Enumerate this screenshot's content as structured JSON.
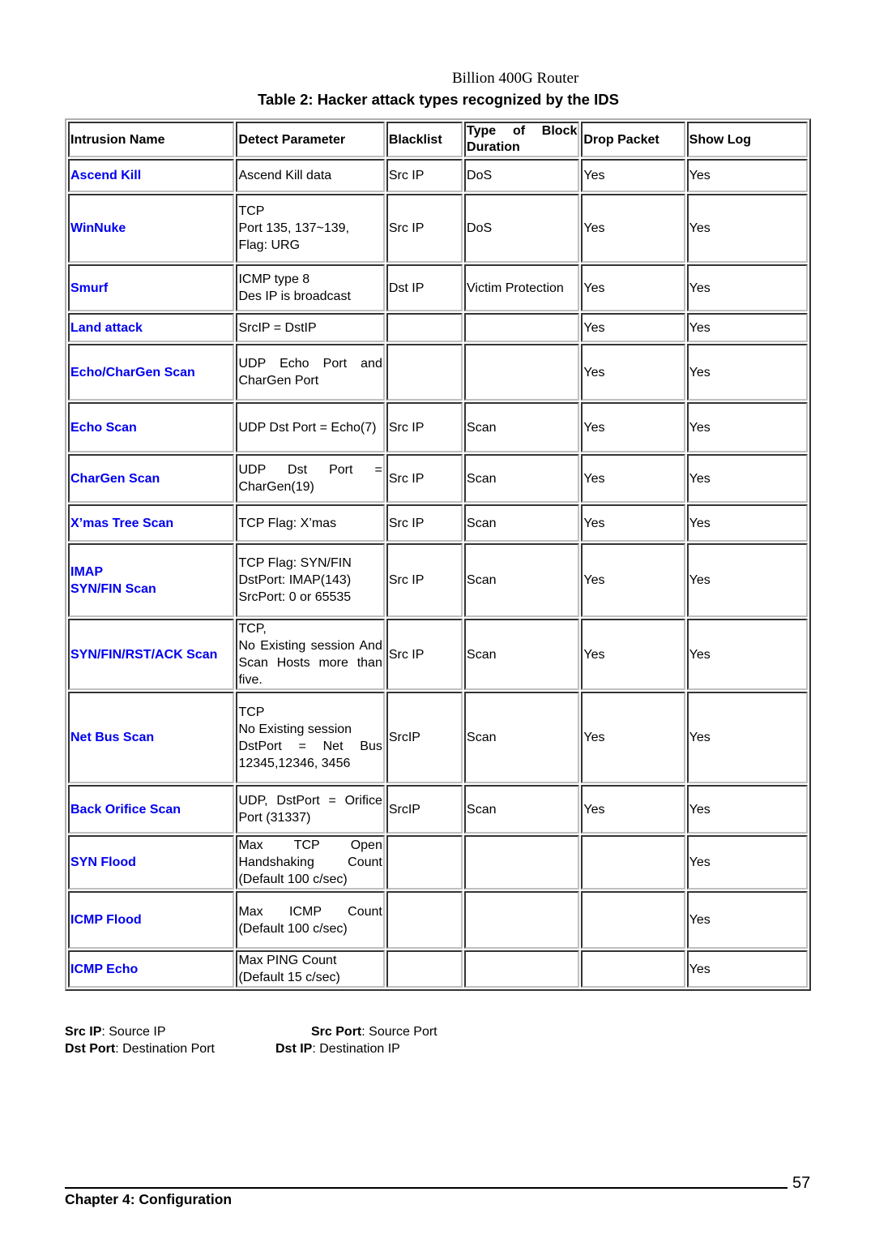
{
  "header": {
    "title": "Billion 400G Router"
  },
  "caption": "Table 2: Hacker attack types recognized by the IDS",
  "table": {
    "columns": [
      "Intrusion Name",
      "Detect Parameter",
      "Blacklist",
      "Type of Block Duration",
      "Drop Packet",
      "Show Log"
    ],
    "rows": [
      {
        "name": [
          "Ascend Kill"
        ],
        "param": [
          "Ascend Kill data"
        ],
        "blacklist": "Src IP",
        "block": "DoS",
        "drop": "Yes",
        "log": "Yes"
      },
      {
        "name": [
          "WinNuke"
        ],
        "param": [
          "TCP",
          "Port 135, 137~139,",
          "Flag: URG"
        ],
        "blacklist": "Src IP",
        "block": "DoS",
        "drop": "Yes",
        "log": "Yes"
      },
      {
        "name": [
          "Smurf"
        ],
        "param": [
          "ICMP type 8",
          "Des IP is broadcast"
        ],
        "blacklist": "Dst IP",
        "block": "Victim Protection",
        "drop": "Yes",
        "log": "Yes"
      },
      {
        "name": [
          "Land attack"
        ],
        "param": [
          "SrcIP = DstIP"
        ],
        "blacklist": "",
        "block": "",
        "drop": "Yes",
        "log": "Yes"
      },
      {
        "name": [
          "Echo/CharGen Scan"
        ],
        "param": [
          "UDP Echo Port and CharGen Port"
        ],
        "blacklist": "",
        "block": "",
        "drop": "Yes",
        "log": "Yes"
      },
      {
        "name": [
          "Echo Scan"
        ],
        "param": [
          "UDP Dst Port = Echo(7)"
        ],
        "blacklist": "Src IP",
        "block": "Scan",
        "drop": "Yes",
        "log": "Yes"
      },
      {
        "name": [
          "CharGen Scan"
        ],
        "param": [
          "UDP Dst Port = CharGen(19)"
        ],
        "blacklist": "Src IP",
        "block": "Scan",
        "drop": "Yes",
        "log": "Yes"
      },
      {
        "name": [
          "X’mas Tree Scan"
        ],
        "param": [
          "TCP Flag: X’mas"
        ],
        "blacklist": "Src IP",
        "block": "Scan",
        "drop": "Yes",
        "log": "Yes"
      },
      {
        "name": [
          "IMAP",
          "SYN/FIN Scan"
        ],
        "param": [
          "TCP Flag: SYN/FIN",
          "DstPort: IMAP(143)",
          "SrcPort: 0 or 65535"
        ],
        "blacklist": "Src IP",
        "block": "Scan",
        "drop": "Yes",
        "log": "Yes"
      },
      {
        "name": [
          "SYN/FIN/RST/ACK Scan"
        ],
        "param": [
          "TCP,",
          "No Existing session And Scan Hosts more than five."
        ],
        "blacklist": "Src IP",
        "block": "Scan",
        "drop": "Yes",
        "log": "Yes"
      },
      {
        "name": [
          "Net Bus Scan"
        ],
        "param": [
          "TCP",
          "No Existing session",
          "DstPort = Net Bus 12345,12346, 3456"
        ],
        "blacklist": "SrcIP",
        "block": "Scan",
        "drop": "Yes",
        "log": "Yes"
      },
      {
        "name": [
          "Back Orifice Scan"
        ],
        "param": [
          "UDP, DstPort = Orifice Port (31337)"
        ],
        "blacklist": "SrcIP",
        "block": "Scan",
        "drop": "Yes",
        "log": "Yes"
      },
      {
        "name": [
          "SYN Flood"
        ],
        "param": [
          "Max TCP Open Handshaking Count (Default 100 c/sec)"
        ],
        "blacklist": "",
        "block": "",
        "drop": "",
        "log": "Yes"
      },
      {
        "name": [
          "ICMP Flood"
        ],
        "param": [
          "Max ICMP Count (Default 100 c/sec)"
        ],
        "blacklist": "",
        "block": "",
        "drop": "",
        "log": "Yes"
      },
      {
        "name": [
          "ICMP Echo"
        ],
        "param": [
          "Max PING Count",
          "(Default 15 c/sec)"
        ],
        "blacklist": "",
        "block": "",
        "drop": "",
        "log": "Yes"
      }
    ]
  },
  "legend": [
    {
      "term": "Src IP",
      "definition": ": Source IP"
    },
    {
      "term": "Src Port",
      "definition": ": Source Port"
    },
    {
      "term": "Dst Port",
      "definition": ": Destination Port"
    },
    {
      "term": "Dst IP",
      "definition": ": Destination IP"
    }
  ],
  "footer": {
    "chapter": "Chapter 4: Configuration",
    "page_number": "57"
  },
  "colors": {
    "link_blue": "#0000ee",
    "text": "#000000"
  }
}
